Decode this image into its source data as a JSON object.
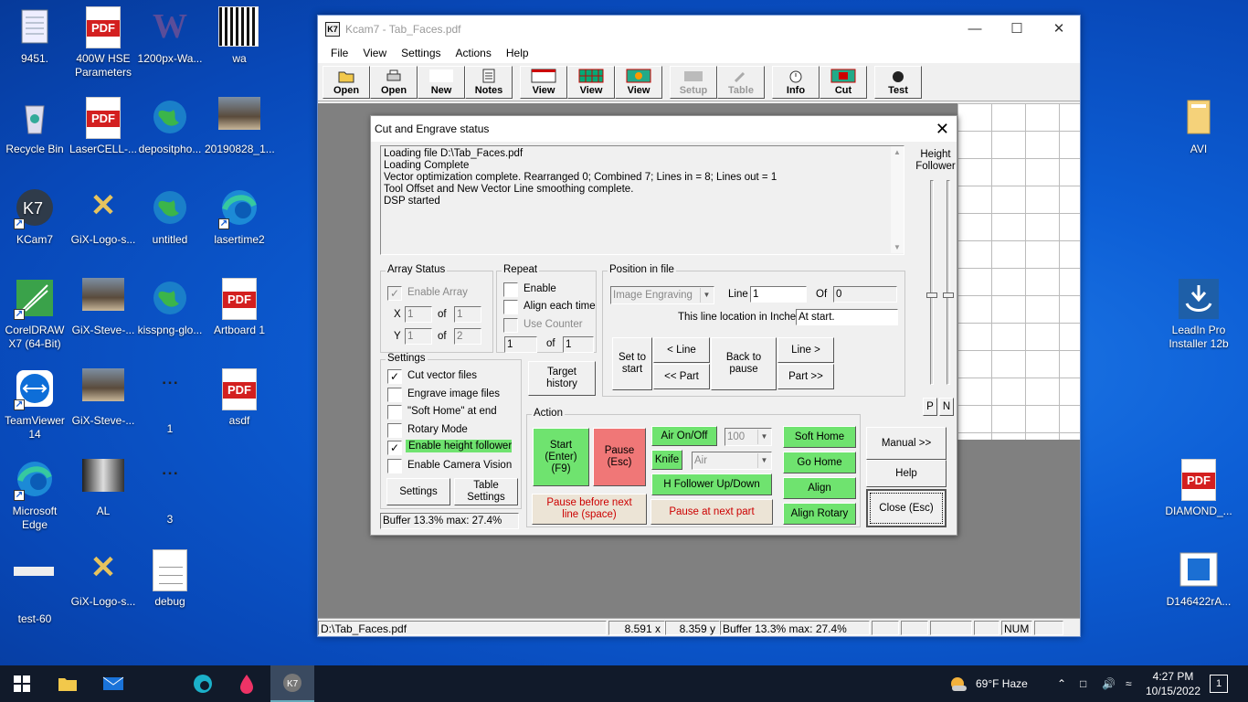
{
  "desktop": {
    "icons": [
      {
        "label": "9451.",
        "kind": "notepad"
      },
      {
        "label": "400W HSE Parameters",
        "kind": "pdf"
      },
      {
        "label": "1200px-Wa...",
        "kind": "w"
      },
      {
        "label": "wa",
        "kind": "qr"
      },
      {
        "label": "Recycle Bin",
        "kind": "bin"
      },
      {
        "label": "LaserCELL-...",
        "kind": "pdf"
      },
      {
        "label": "depositpho...",
        "kind": "globe"
      },
      {
        "label": "20190828_1...",
        "kind": "photo"
      },
      {
        "label": "KCam7",
        "kind": "k7"
      },
      {
        "label": "GiX-Logo-s...",
        "kind": "gix"
      },
      {
        "label": "untitled",
        "kind": "globe"
      },
      {
        "label": "lasertime2",
        "kind": "edge"
      },
      {
        "label": "CorelDRAW X7 (64-Bit)",
        "kind": "corel"
      },
      {
        "label": "GiX-Steve-...",
        "kind": "photo"
      },
      {
        "label": "kisspng-glo...",
        "kind": "globe"
      },
      {
        "label": "Artboard 1",
        "kind": "pdf"
      },
      {
        "label": "TeamViewer 14",
        "kind": "tv"
      },
      {
        "label": "GiX-Steve-...",
        "kind": "photo"
      },
      {
        "label": "1",
        "kind": "small"
      },
      {
        "label": "asdf",
        "kind": "pdf"
      },
      {
        "label": "Microsoft Edge",
        "kind": "edge"
      },
      {
        "label": "AL",
        "kind": "photo2"
      },
      {
        "label": "3",
        "kind": "small"
      },
      {
        "label": "test-60",
        "kind": "bar"
      },
      {
        "label": "GiX-Logo-s...",
        "kind": "gix"
      },
      {
        "label": "debug",
        "kind": "doc"
      },
      {
        "label": "AVI",
        "kind": "folder"
      },
      {
        "label": "LeadIn Pro Installer 12b",
        "kind": "leadin"
      },
      {
        "label": "DIAMOND_...",
        "kind": "pdf"
      },
      {
        "label": "D146422rA...",
        "kind": "img"
      }
    ]
  },
  "window": {
    "title": "Kcam7 - Tab_Faces.pdf",
    "app_icon": "K7",
    "menu": [
      "File",
      "View",
      "Settings",
      "Actions",
      "Help"
    ],
    "toolbar": [
      "Open",
      "Open",
      "New",
      "Notes",
      "View",
      "View",
      "View",
      "Setup",
      "Table",
      "Info",
      "Cut",
      "Test"
    ],
    "status": {
      "file": "D:\\Tab_Faces.pdf",
      "x": "8.591 x",
      "y": "8.359 y",
      "buffer": "Buffer  13.3% max: 27.4%",
      "num": "NUM"
    }
  },
  "dialog": {
    "title": "Cut and Engrave status",
    "log": [
      "Loading file D:\\Tab_Faces.pdf",
      "Loading Complete",
      "Vector optimization complete. Rearranged 0; Combined 7; Lines in = 8; Lines out = 1",
      "Tool Offset and New Vector Line smoothing complete.",
      "DSP started"
    ],
    "height_follower": "Height Follower",
    "p": "P",
    "n": "N",
    "array": {
      "title": "Array Status",
      "enable": "Enable Array",
      "x_label": "X",
      "x_val": "1",
      "x_of": "of",
      "x_total": "1",
      "y_label": "Y",
      "y_val": "1",
      "y_of": "of",
      "y_total": "2"
    },
    "repeat": {
      "title": "Repeat",
      "enable": "Enable",
      "align": "Align each time",
      "counter": "Use Counter",
      "val": "1",
      "of": "of",
      "total": "1"
    },
    "position": {
      "title": "Position in file",
      "mode": "Image Engraving",
      "line_label": "Line",
      "line_val": "1",
      "of_label": "Of",
      "of_val": "0",
      "loc_label": "This line location in Inches",
      "loc_val": "At start.",
      "set_start": "Set to start",
      "prev_line": "< Line",
      "prev_part": "<< Part",
      "back": "Back to pause",
      "next_line": "Line >",
      "next_part": "Part >>"
    },
    "settings": {
      "title": "Settings",
      "cut_vector": "Cut vector files",
      "engrave_image": "Engrave image files",
      "soft_home": "\"Soft Home\" at end",
      "rotary": "Rotary Mode",
      "height_follower": "Enable height follower",
      "camera": "Enable Camera Vision",
      "settings_btn": "Settings",
      "table_btn": "Table Settings"
    },
    "target_history": "Target history",
    "buffer": "Buffer  13.3% max: 27.4%",
    "action": {
      "title": "Action",
      "start": "Start (Enter)(F9)",
      "pause": "Pause (Esc)",
      "pause_line": "Pause before next line (space)",
      "air": "Air On/Off",
      "power": "100",
      "knife": "Knife",
      "gas": "Air",
      "hfollower": "H Follower Up/Down",
      "pause_part": "Pause at next part",
      "soft_home": "Soft Home",
      "go_home": "Go Home",
      "align": "Align",
      "align_rotary": "Align Rotary"
    },
    "manual": "Manual >>",
    "help": "Help",
    "close": "Close (Esc)"
  },
  "taskbar": {
    "weather": "69°F  Haze",
    "time": "4:27 PM",
    "date": "10/15/2022",
    "notif": "1"
  }
}
